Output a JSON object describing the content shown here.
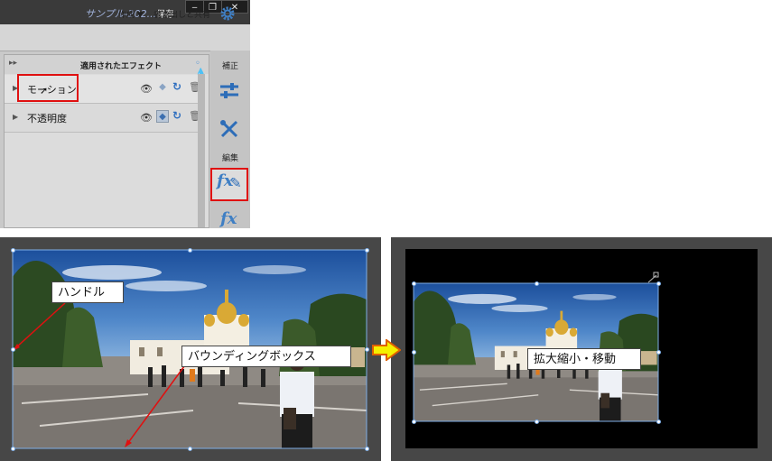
{
  "window": {
    "title": "サンプル-202...",
    "save_label": "保存",
    "minimize": "‒",
    "maximize": "❐",
    "close": "✕"
  },
  "toolbar": {
    "create_label": "作成 ▼",
    "export_label": "書き出しと共有"
  },
  "effects_panel": {
    "title": "適用されたエフェクト",
    "rows": [
      {
        "label": "モーション"
      },
      {
        "label": "不透明度"
      }
    ]
  },
  "right_panel": {
    "adjust_label": "補正",
    "edit_label": "編集",
    "fx_label": "fx"
  },
  "callouts": {
    "handle": "ハンドル",
    "bounding_box": "バウンディングボックス",
    "scale_move": "拡大縮小・移動"
  },
  "colors": {
    "highlight_red": "#e01010",
    "arrow_fill": "#f5f000",
    "arrow_stroke": "#e06000",
    "accent_blue": "#3f7fc4",
    "panel_dark": "#474747"
  }
}
